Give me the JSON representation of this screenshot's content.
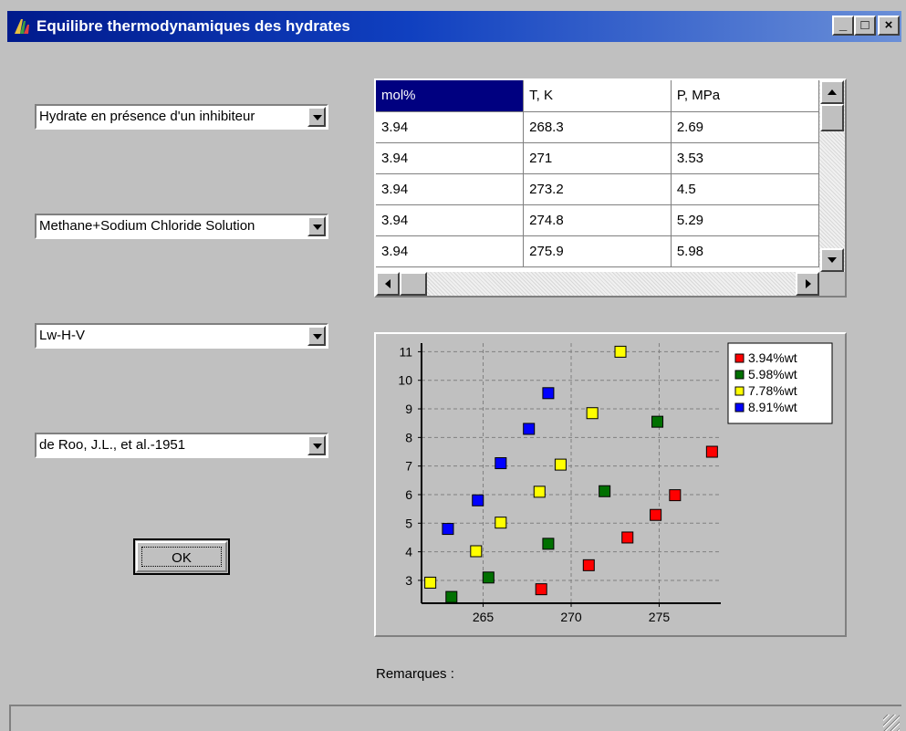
{
  "window": {
    "title": "Equilibre thermodynamiques des hydrates",
    "minimize_label": "_",
    "maximize_label": "□",
    "close_label": "×"
  },
  "combos": {
    "hydrate_type": "Hydrate en présence d'un inhibiteur",
    "system": "Methane+Sodium Chloride Solution",
    "phases": "Lw-H-V",
    "reference": "de Roo, J.L., et al.-1951"
  },
  "ok_button": "OK",
  "grid": {
    "headers": [
      "mol%",
      "T, K",
      "P, MPa"
    ],
    "rows": [
      [
        "3.94",
        "268.3",
        "2.69"
      ],
      [
        "3.94",
        "271",
        "3.53"
      ],
      [
        "3.94",
        "273.2",
        "4.5"
      ],
      [
        "3.94",
        "274.8",
        "5.29"
      ],
      [
        "3.94",
        "275.9",
        "5.98"
      ]
    ]
  },
  "remarks_label": "Remarques :",
  "chart_data": {
    "type": "scatter",
    "xlim": [
      261.5,
      278.5
    ],
    "ylim": [
      2.2,
      11.3
    ],
    "x_ticks": [
      265,
      270,
      275
    ],
    "y_ticks": [
      3,
      4,
      5,
      6,
      7,
      8,
      9,
      10,
      11
    ],
    "grid": true,
    "legend_position": "top-right",
    "series": [
      {
        "name": "3.94%wt",
        "color": "#ff0000",
        "points": [
          [
            268.3,
            2.69
          ],
          [
            271,
            3.53
          ],
          [
            273.2,
            4.5
          ],
          [
            274.8,
            5.29
          ],
          [
            275.9,
            5.98
          ],
          [
            278.0,
            7.5
          ]
        ]
      },
      {
        "name": "5.98%wt",
        "color": "#007000",
        "points": [
          [
            263.2,
            2.42
          ],
          [
            265.3,
            3.1
          ],
          [
            268.7,
            4.28
          ],
          [
            271.9,
            6.12
          ],
          [
            274.9,
            8.55
          ]
        ]
      },
      {
        "name": "7.78%wt",
        "color": "#ffff00",
        "points": [
          [
            262.0,
            2.92
          ],
          [
            264.6,
            4.02
          ],
          [
            266.0,
            5.02
          ],
          [
            268.2,
            6.1
          ],
          [
            269.4,
            7.05
          ],
          [
            271.2,
            8.85
          ],
          [
            272.8,
            11.0
          ]
        ]
      },
      {
        "name": "8.91%wt",
        "color": "#0000ff",
        "points": [
          [
            263.0,
            4.8
          ],
          [
            264.7,
            5.8
          ],
          [
            266.0,
            7.1
          ],
          [
            267.6,
            8.3
          ],
          [
            268.7,
            9.55
          ]
        ]
      }
    ]
  }
}
